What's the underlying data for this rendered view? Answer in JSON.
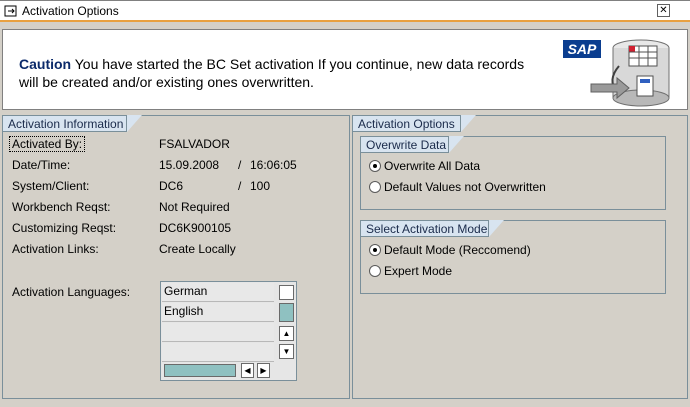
{
  "window": {
    "title": "Activation Options",
    "close_icon": "close-icon"
  },
  "banner": {
    "caution_label": "Caution",
    "caution_message": "You have started the BC Set activation If you continue, new data records will be created and/or existing ones overwritten.",
    "logo_text": "SAP"
  },
  "info": {
    "title": "Activation Information",
    "activated_by_label": "Activated By:",
    "activated_by_value": "FSALVADOR",
    "datetime_label": "Date/Time:",
    "date_value": "15.09.2008",
    "date_sep": "/",
    "time_value": "16:06:05",
    "system_label": "System/Client:",
    "system_value": "DC6",
    "client_sep": "/",
    "client_value": "100",
    "workbench_label": "Workbench Reqst:",
    "workbench_value": "Not Required",
    "customizing_label": "Customizing Reqst:",
    "customizing_value": "DC6K900105",
    "links_label": "Activation Links:",
    "links_value": "Create Locally",
    "languages_label": "Activation Languages:",
    "languages": [
      "German",
      "English",
      "",
      ""
    ]
  },
  "options": {
    "title": "Activation Options",
    "overwrite": {
      "title": "Overwrite Data",
      "items": [
        {
          "label": "Overwrite All Data",
          "selected": true
        },
        {
          "label": "Default Values not Overwritten",
          "selected": false
        }
      ]
    },
    "mode": {
      "title": "Select Activation Mode",
      "items": [
        {
          "label": "Default Mode (Reccomend)",
          "selected": true
        },
        {
          "label": "Expert Mode",
          "selected": false
        }
      ]
    }
  },
  "colors": {
    "accent": "#e8a040",
    "tab_bg": "#d8e4f0",
    "background": "#d4d0c8",
    "caution": "#0b2a6a"
  }
}
